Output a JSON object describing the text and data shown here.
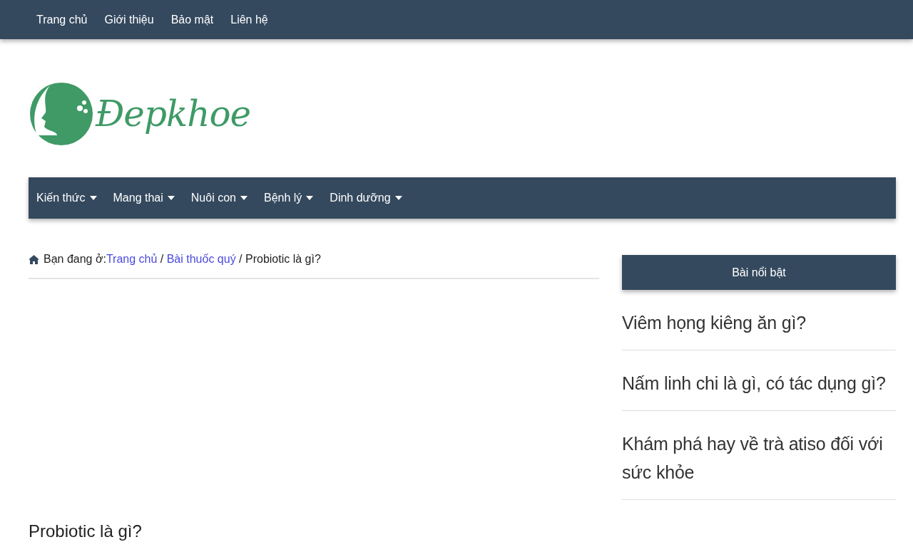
{
  "top_nav": [
    "Trang chủ",
    "Giới thiệu",
    "Bảo mật",
    "Liên hệ"
  ],
  "logo": {
    "text": "Đepkhoe"
  },
  "main_menu": [
    {
      "label": "Kiến thức",
      "has_dropdown": true
    },
    {
      "label": "Mang thai",
      "has_dropdown": true
    },
    {
      "label": "Nuôi con",
      "has_dropdown": true
    },
    {
      "label": "Bệnh lý",
      "has_dropdown": true
    },
    {
      "label": "Dinh dưỡng",
      "has_dropdown": true
    }
  ],
  "breadcrumb": {
    "prefix": "Bạn đang ở:",
    "separator": "/",
    "links": [
      "Trang chủ",
      "Bài thuốc quý"
    ],
    "current": "Probiotic là gì?"
  },
  "article": {
    "title": "Probiotic là gì?"
  },
  "sidebar": {
    "heading": "Bài nổi bật",
    "posts": [
      "Viêm họng kiêng ăn gì?",
      "Nấm linh chi là gì, có tác dụng gì?",
      "Khám phá hay về trà atiso đối với sức khỏe"
    ]
  }
}
